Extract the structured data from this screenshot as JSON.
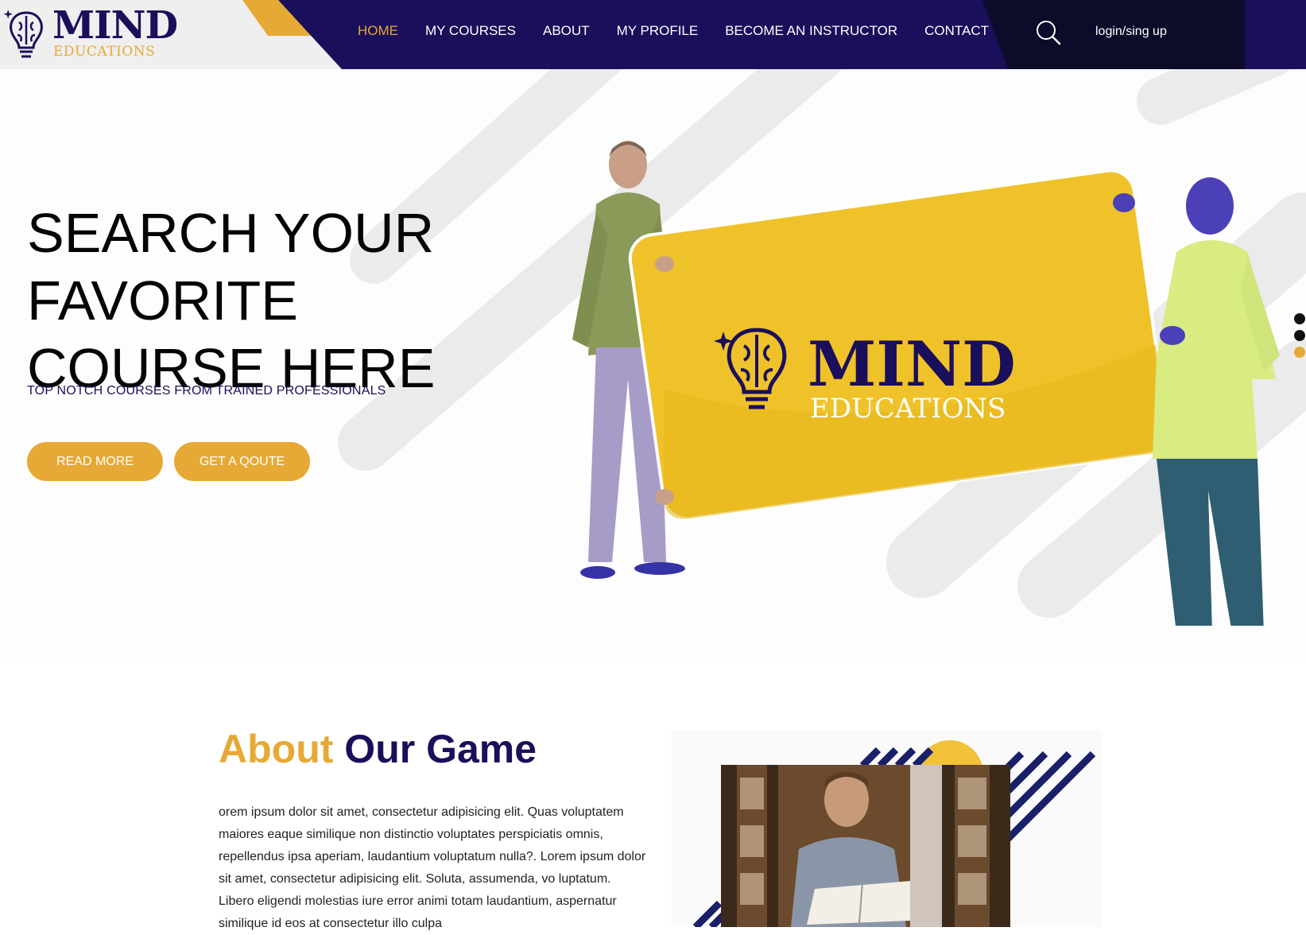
{
  "header": {
    "logo": {
      "title": "MIND",
      "subtitle": "EDUCATIONS"
    },
    "nav": [
      {
        "label": "HOME",
        "active": true
      },
      {
        "label": "MY COURSES",
        "active": false
      },
      {
        "label": "ABOUT",
        "active": false
      },
      {
        "label": "MY PROFILE",
        "active": false
      },
      {
        "label": "BECOME AN INSTRUCTOR",
        "active": false
      },
      {
        "label": "CONTACT",
        "active": false
      }
    ],
    "search_icon": "search-icon",
    "login_label": "login/sing up"
  },
  "hero": {
    "title_lines": [
      "SEARCH YOUR",
      "FAVORITE",
      "COURSE HERE"
    ],
    "subtitle": "TOP NOTCH COURSES FROM TRAINED PROFESSIONALS",
    "read_more_label": "READ MORE",
    "quote_label": "GET A QOUTE",
    "sign": {
      "title": "MIND",
      "subtitle": "EDUCATIONS"
    },
    "slider_dots": 3,
    "active_dot": 3
  },
  "about": {
    "title_part1": "About",
    "title_part2": "Our Game",
    "text": "orem ipsum dolor sit amet, consectetur adipisicing elit. Quas voluptatem maiores eaque similique non distinctio voluptates perspiciatis omnis, repellendus ipsa aperiam, laudantium voluptatum nulla?. Lorem ipsum dolor sit amet, consectetur adipisicing elit. Soluta, assumenda, vo luptatum. Libero eligendi molestias iure error animi totam laudantium, aspernatur similique id eos at consectetur illo culpa"
  },
  "colors": {
    "navy": "#1a0f5a",
    "gold": "#e7a935",
    "dark": "#0d0b2a",
    "sign_yellow": "#f0c22a"
  }
}
